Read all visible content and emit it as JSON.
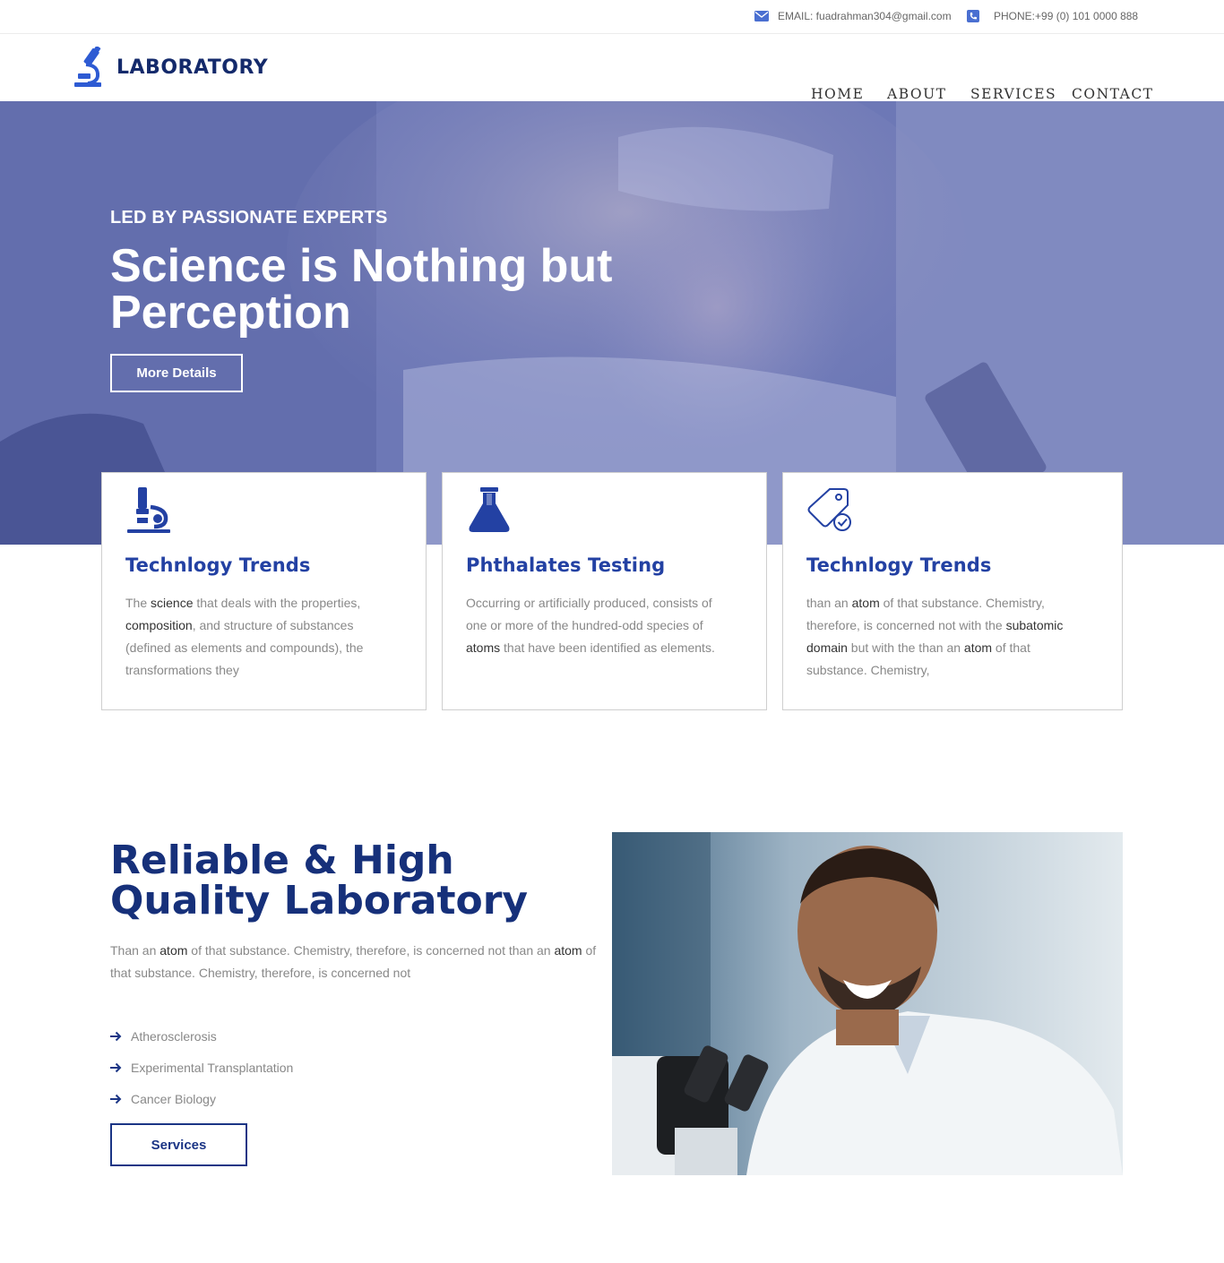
{
  "topbar": {
    "email": "EMAIL: fuadrahman304@gmail.com",
    "phone": "PHONE:+99 (0) 101 0000 888"
  },
  "brand": {
    "name": "LABORATORY"
  },
  "nav": {
    "items": [
      "HOME",
      "ABOUT",
      "SERVICES",
      "CONTACT"
    ]
  },
  "hero": {
    "subtitle": "LED BY PASSIONATE EXPERTS",
    "title": "Science is Nothing but Perception",
    "button": "More Details"
  },
  "cards": [
    {
      "icon": "microscope-icon",
      "title": "Technlogy Trends",
      "text_parts": [
        {
          "t": "The ",
          "dark": false
        },
        {
          "t": "science",
          "dark": true
        },
        {
          "t": " that deals with the properties, ",
          "dark": false
        },
        {
          "t": "composition",
          "dark": true
        },
        {
          "t": ", and structure of substances (defined as elements and compounds), the transformations they",
          "dark": false
        }
      ]
    },
    {
      "icon": "flask-icon",
      "title": "Phthalates Testing",
      "text_parts": [
        {
          "t": "Occurring or artificially produced, consists of one or more of the hundred-odd species of ",
          "dark": false
        },
        {
          "t": "atoms",
          "dark": true
        },
        {
          "t": " that have been identified as elements.",
          "dark": false
        }
      ]
    },
    {
      "icon": "tag-check-icon",
      "title": "Technlogy Trends",
      "text_parts": [
        {
          "t": "than an ",
          "dark": false
        },
        {
          "t": "atom",
          "dark": true
        },
        {
          "t": " of that substance. Chemistry, therefore, is concerned not with the ",
          "dark": false
        },
        {
          "t": "subatomic domain",
          "dark": true
        },
        {
          "t": " but with the than an ",
          "dark": false
        },
        {
          "t": "atom",
          "dark": true
        },
        {
          "t": " of that substance. Chemistry,",
          "dark": false
        }
      ]
    }
  ],
  "about": {
    "title": "Reliable & High Quality Laboratory",
    "text_parts": [
      {
        "t": "Than an ",
        "dark": false
      },
      {
        "t": "atom",
        "dark": true
      },
      {
        "t": " of that substance. Chemistry, therefore, is concerned not than an ",
        "dark": false
      },
      {
        "t": "atom",
        "dark": true
      },
      {
        "t": " of that substance. Chemistry, therefore, is concerned not",
        "dark": false
      }
    ],
    "list": [
      "Atherosclerosis",
      "Experimental Transplantation",
      "Cancer Biology"
    ],
    "button": "Services"
  },
  "colors": {
    "brand": "#142a6b",
    "accent": "#2341a3",
    "hero_overlay": "#6b76b4"
  }
}
